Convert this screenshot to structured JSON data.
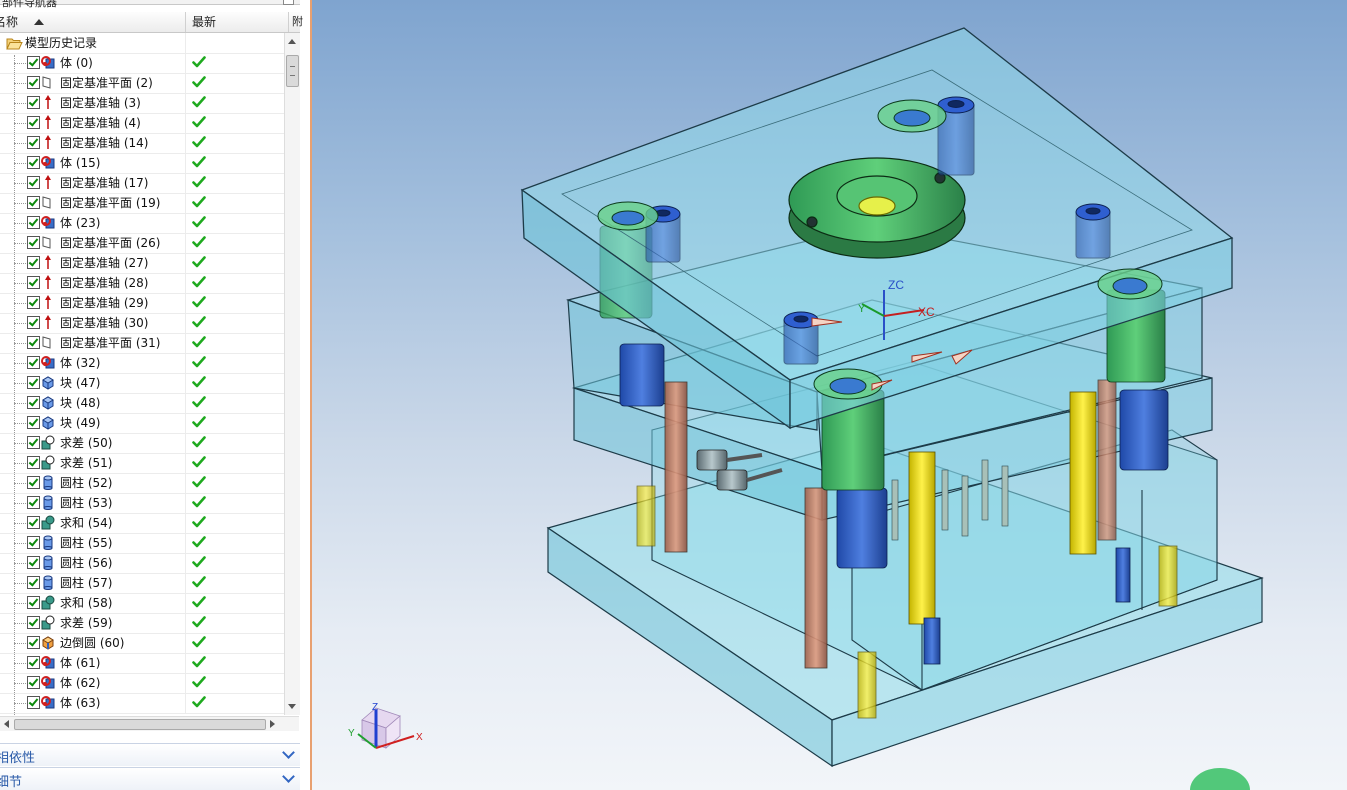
{
  "navigator": {
    "panel_title": "部件导航器",
    "columns": {
      "name": "名称",
      "latest": "最新",
      "extra": "附"
    },
    "root": {
      "label": "模型历史记录"
    },
    "features": [
      {
        "label": "体 (0)",
        "icon": "body-icon"
      },
      {
        "label": "固定基准平面 (2)",
        "icon": "datum-plane-icon"
      },
      {
        "label": "固定基准轴 (3)",
        "icon": "datum-axis-icon"
      },
      {
        "label": "固定基准轴 (4)",
        "icon": "datum-axis-icon"
      },
      {
        "label": "固定基准轴 (14)",
        "icon": "datum-axis-icon"
      },
      {
        "label": "体 (15)",
        "icon": "body-icon"
      },
      {
        "label": "固定基准轴 (17)",
        "icon": "datum-axis-icon"
      },
      {
        "label": "固定基准平面 (19)",
        "icon": "datum-plane-icon"
      },
      {
        "label": "体 (23)",
        "icon": "body-icon"
      },
      {
        "label": "固定基准平面 (26)",
        "icon": "datum-plane-icon"
      },
      {
        "label": "固定基准轴 (27)",
        "icon": "datum-axis-icon"
      },
      {
        "label": "固定基准轴 (28)",
        "icon": "datum-axis-icon"
      },
      {
        "label": "固定基准轴 (29)",
        "icon": "datum-axis-icon"
      },
      {
        "label": "固定基准轴 (30)",
        "icon": "datum-axis-icon"
      },
      {
        "label": "固定基准平面 (31)",
        "icon": "datum-plane-icon"
      },
      {
        "label": "体 (32)",
        "icon": "body-icon"
      },
      {
        "label": "块 (47)",
        "icon": "block-icon"
      },
      {
        "label": "块 (48)",
        "icon": "block-icon"
      },
      {
        "label": "块 (49)",
        "icon": "block-icon"
      },
      {
        "label": "求差 (50)",
        "icon": "subtract-icon"
      },
      {
        "label": "求差 (51)",
        "icon": "subtract-icon"
      },
      {
        "label": "圆柱 (52)",
        "icon": "cylinder-icon"
      },
      {
        "label": "圆柱 (53)",
        "icon": "cylinder-icon"
      },
      {
        "label": "求和 (54)",
        "icon": "unite-icon"
      },
      {
        "label": "圆柱 (55)",
        "icon": "cylinder-icon"
      },
      {
        "label": "圆柱 (56)",
        "icon": "cylinder-icon"
      },
      {
        "label": "圆柱 (57)",
        "icon": "cylinder-icon"
      },
      {
        "label": "求和 (58)",
        "icon": "unite-icon"
      },
      {
        "label": "求差 (59)",
        "icon": "subtract-icon"
      },
      {
        "label": "边倒圆 (60)",
        "icon": "edge-blend-icon"
      },
      {
        "label": "体 (61)",
        "icon": "body-icon"
      },
      {
        "label": "体 (62)",
        "icon": "body-icon"
      },
      {
        "label": "体 (63)",
        "icon": "body-icon"
      }
    ],
    "sections": [
      {
        "title": "相依性"
      },
      {
        "title": "细节"
      }
    ]
  },
  "viewport": {
    "csys_labels": {
      "zc": "ZC",
      "xc": "XC",
      "yc": "Y"
    },
    "triad_labels": {
      "z": "Z",
      "x": "X",
      "y": "Y"
    },
    "colors": {
      "plate": "#7fd6e6",
      "sprue_bushing": "#3aa85a",
      "leader_pin": "#2f5fd0",
      "ejector_pin_yellow": "#f0e020",
      "return_pin": "#d9886a"
    }
  }
}
